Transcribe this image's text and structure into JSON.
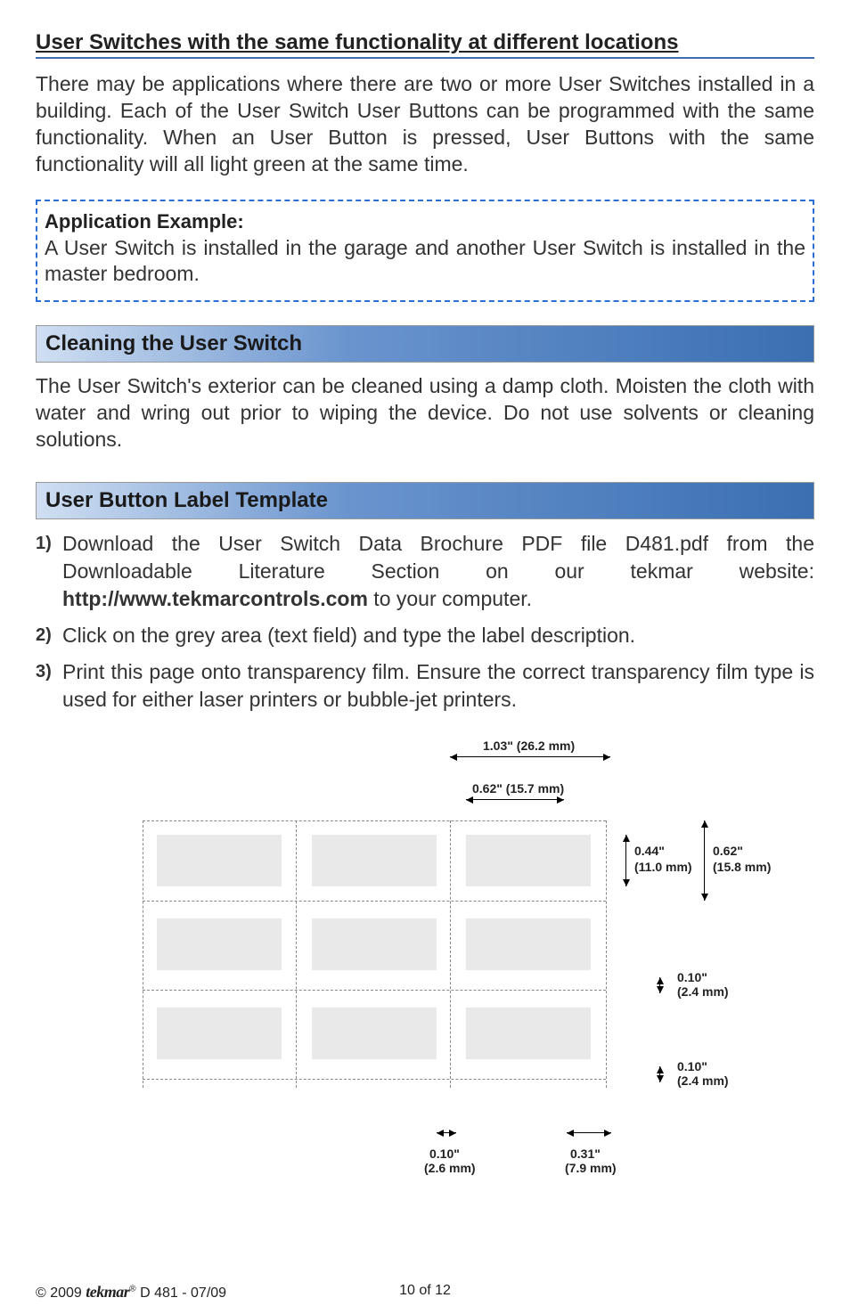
{
  "section1": {
    "heading": "User Switches with the same functionality at different locations",
    "paragraph": "There may be applications where there are two or more User Switches installed in a building. Each of the User Switch User Buttons can be programmed with the same functionality. When an User Button is pressed, User Buttons with the same functionality will all light green at the same time."
  },
  "appbox": {
    "title": "Application Example:",
    "text": "A User Switch is installed in the garage and another User Switch is installed in the master bedroom."
  },
  "section2": {
    "heading": "Cleaning the User Switch",
    "paragraph": "The User Switch's exterior can be cleaned using a damp cloth. Moisten the cloth with water and wring out prior to wiping the device. Do not use solvents or cleaning solutions."
  },
  "section3": {
    "heading": "User Button Label Template",
    "steps": [
      {
        "pre": "Download the User Switch Data Brochure PDF file D481.pdf from the Downloadable Literature Section on our tekmar website: ",
        "bold": "http://www.tekmarcontrols.com",
        "post": " to your computer."
      },
      {
        "text": "Click on the grey area (text field) and type the label description."
      },
      {
        "text": "Print this page onto transparency film. Ensure the correct transparency film type is used for either laser printers or bubble-jet printers."
      }
    ]
  },
  "dims": {
    "w_outer": "1.03\" (26.2 mm)",
    "w_inner": "0.62\" (15.7 mm)",
    "h_inner_a": "0.44\"",
    "h_inner_b": "(11.0 mm)",
    "h_outer_a": "0.62\"",
    "h_outer_b": "(15.8 mm)",
    "gap1_a": "0.10\"",
    "gap1_b": "(2.4 mm)",
    "gap2_a": "0.10\"",
    "gap2_b": "(2.4 mm)",
    "bw_a": "0.10\"",
    "bw_b": "(2.6 mm)",
    "br_a": "0.31\"",
    "br_b": "(7.9 mm)"
  },
  "footer": {
    "copyright": "© 2009 ",
    "brand": "tekmar",
    "reg": "®",
    "doc": " D 481 - 07/09",
    "page": "10 of 12"
  }
}
